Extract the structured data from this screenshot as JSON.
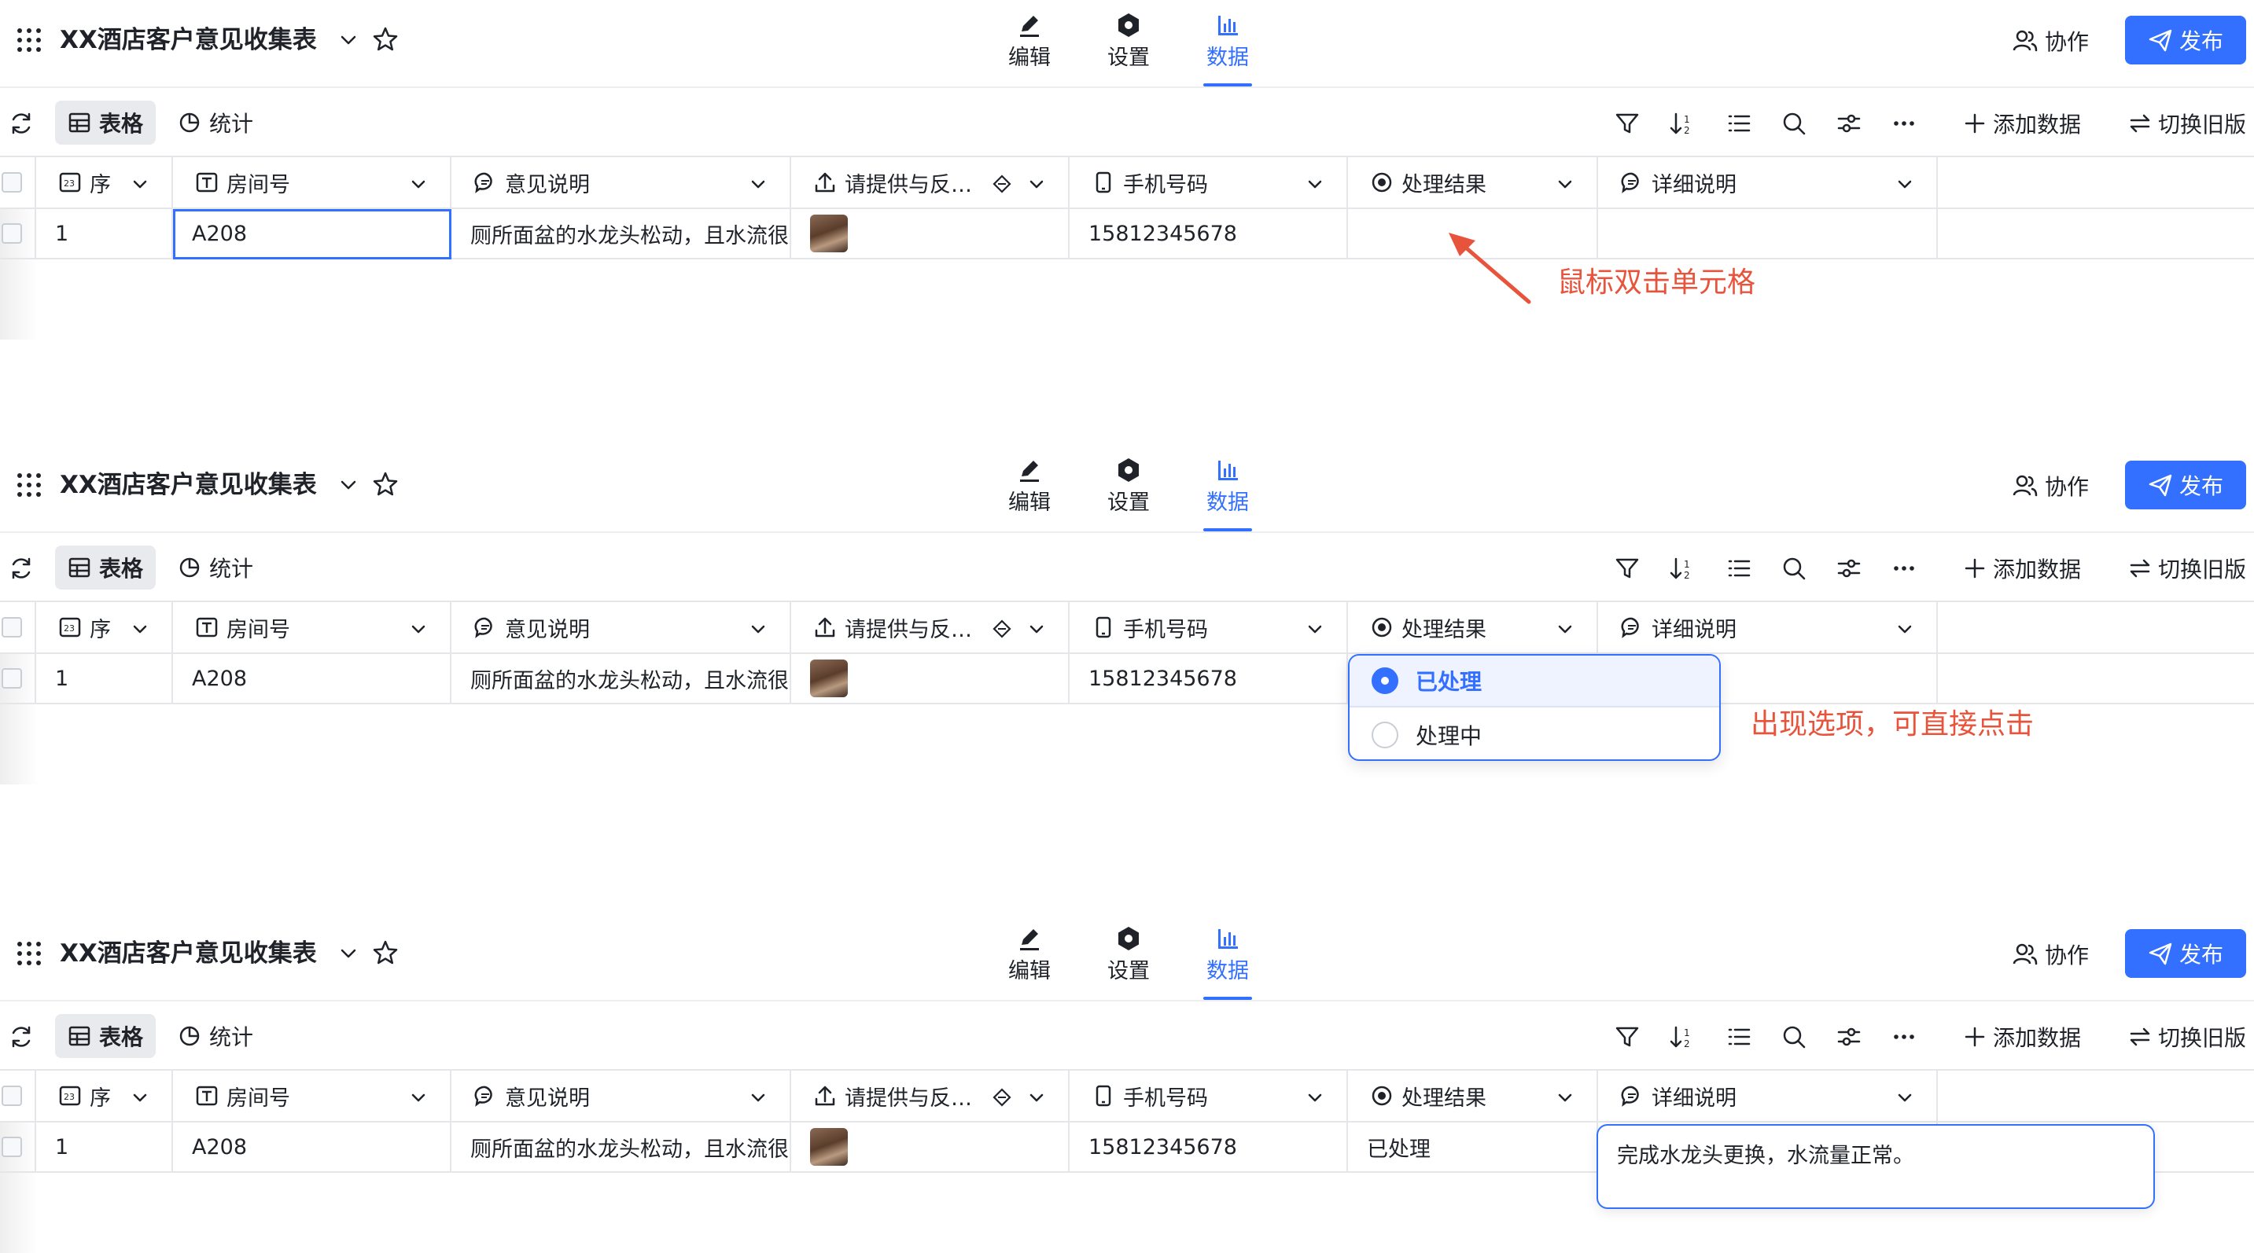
{
  "header": {
    "form_title": "XX酒店客户意见收集表",
    "mode_tabs": [
      {
        "label": "编辑",
        "icon": "pen-icon"
      },
      {
        "label": "设置",
        "icon": "hexagon-settings-icon"
      },
      {
        "label": "数据",
        "icon": "bar-chart-icon"
      }
    ],
    "active_mode_tab": "数据",
    "collab_label": "协作",
    "publish_label": "发布"
  },
  "toolbar": {
    "view_tabs": [
      {
        "label": "表格",
        "icon": "table-icon"
      },
      {
        "label": "统计",
        "icon": "pie-chart-icon"
      }
    ],
    "active_view_tab": "表格",
    "tool_icons": [
      "filter-icon",
      "sort-icon",
      "list-icon",
      "search-icon",
      "settings-sliders-icon",
      "more-icon"
    ],
    "add_data_label": "添加数据",
    "switch_old_label": "切换旧版"
  },
  "columns": [
    {
      "label": "序",
      "icon": "number-icon"
    },
    {
      "label": "房间号",
      "icon": "text-icon"
    },
    {
      "label": "意见说明",
      "icon": "comment-icon"
    },
    {
      "label": "请提供与反…",
      "icon": "upload-icon"
    },
    {
      "label": "手机号码",
      "icon": "phone-icon"
    },
    {
      "label": "处理结果",
      "icon": "radio-icon"
    },
    {
      "label": "详细说明",
      "icon": "comment-icon"
    }
  ],
  "panels": [
    {
      "row": {
        "index": "1",
        "room": "A208",
        "comment": "厕所面盆的水龙头松动，且水流很",
        "phone": "15812345678",
        "result": "",
        "detail": ""
      },
      "annotation": "鼠标双击单元格"
    },
    {
      "row": {
        "index": "1",
        "room": "A208",
        "comment": "厕所面盆的水龙头松动，且水流很",
        "phone": "15812345678",
        "result": "",
        "detail": ""
      },
      "annotation": "出现选项，可直接点击",
      "dropdown_options": [
        "已处理",
        "处理中"
      ],
      "dropdown_selected": "已处理"
    },
    {
      "row": {
        "index": "1",
        "room": "A208",
        "comment": "厕所面盆的水龙头松动，且水流很",
        "phone": "15812345678",
        "result": "已处理",
        "detail": ""
      },
      "edit_value": "完成水龙头更换，水流量正常。"
    }
  ],
  "colors": {
    "accent": "#3370ff",
    "annotation": "#e8533c",
    "border": "#e4e6ea"
  }
}
